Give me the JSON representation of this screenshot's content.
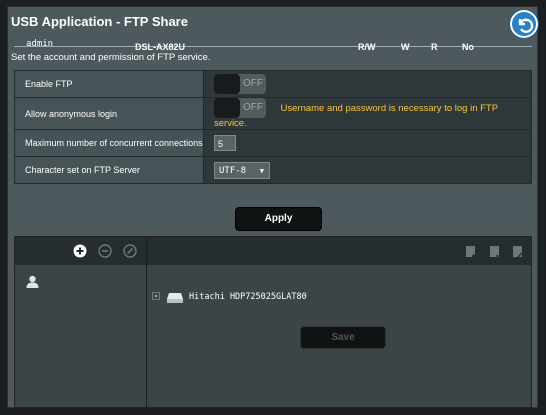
{
  "header": {
    "title": "USB Application - FTP Share"
  },
  "description": "Set the account and permission of FTP service.",
  "settings": {
    "enable_ftp": {
      "label": "Enable FTP",
      "state": "OFF"
    },
    "anonymous": {
      "label": "Allow anonymous login",
      "state": "OFF",
      "note": "Username and password is necessary to log in FTP service."
    },
    "max_conn": {
      "label": "Maximum number of concurrent connections",
      "value": "5"
    },
    "charset": {
      "label": "Character set on FTP Server",
      "value": "UTF-8"
    }
  },
  "apply_label": "Apply",
  "users": [
    {
      "name": "admin"
    }
  ],
  "device": {
    "name": "DSL-AX82U",
    "disk": "Hitachi HDP725025GLAT80"
  },
  "columns": [
    "R/W",
    "W",
    "R",
    "No"
  ],
  "save_label": "Save",
  "colors": {
    "accent": "#2880c6",
    "warning": "#f9c63b"
  }
}
